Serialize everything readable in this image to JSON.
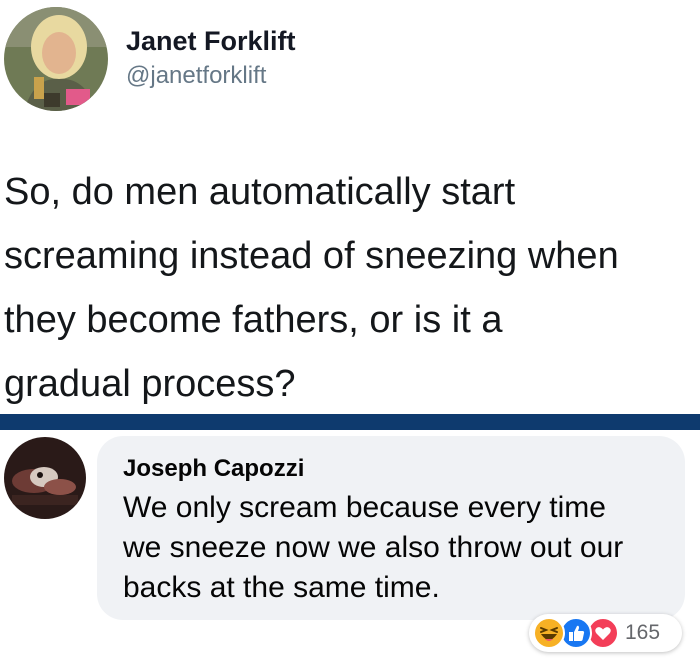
{
  "tweet": {
    "author_name": "Janet Forklift",
    "author_handle": "@janetforklift",
    "text_lines": [
      "So, do men automatically start",
      "screaming instead of sneezing when",
      "they become fathers, or is it a",
      "gradual process?"
    ]
  },
  "comment": {
    "author_name": "Joseph Capozzi",
    "text_lines": [
      "We only scream because every time",
      "we sneeze now we also throw out our",
      "backs at the same time."
    ],
    "reactions": {
      "icons": [
        "haha-icon",
        "like-icon",
        "love-icon"
      ],
      "count": "165"
    }
  },
  "colors": {
    "divider": "#0e3a6e",
    "bubble": "#f0f2f5",
    "like": "#1877f2",
    "love": "#f33e58",
    "haha": "#f7b125"
  }
}
